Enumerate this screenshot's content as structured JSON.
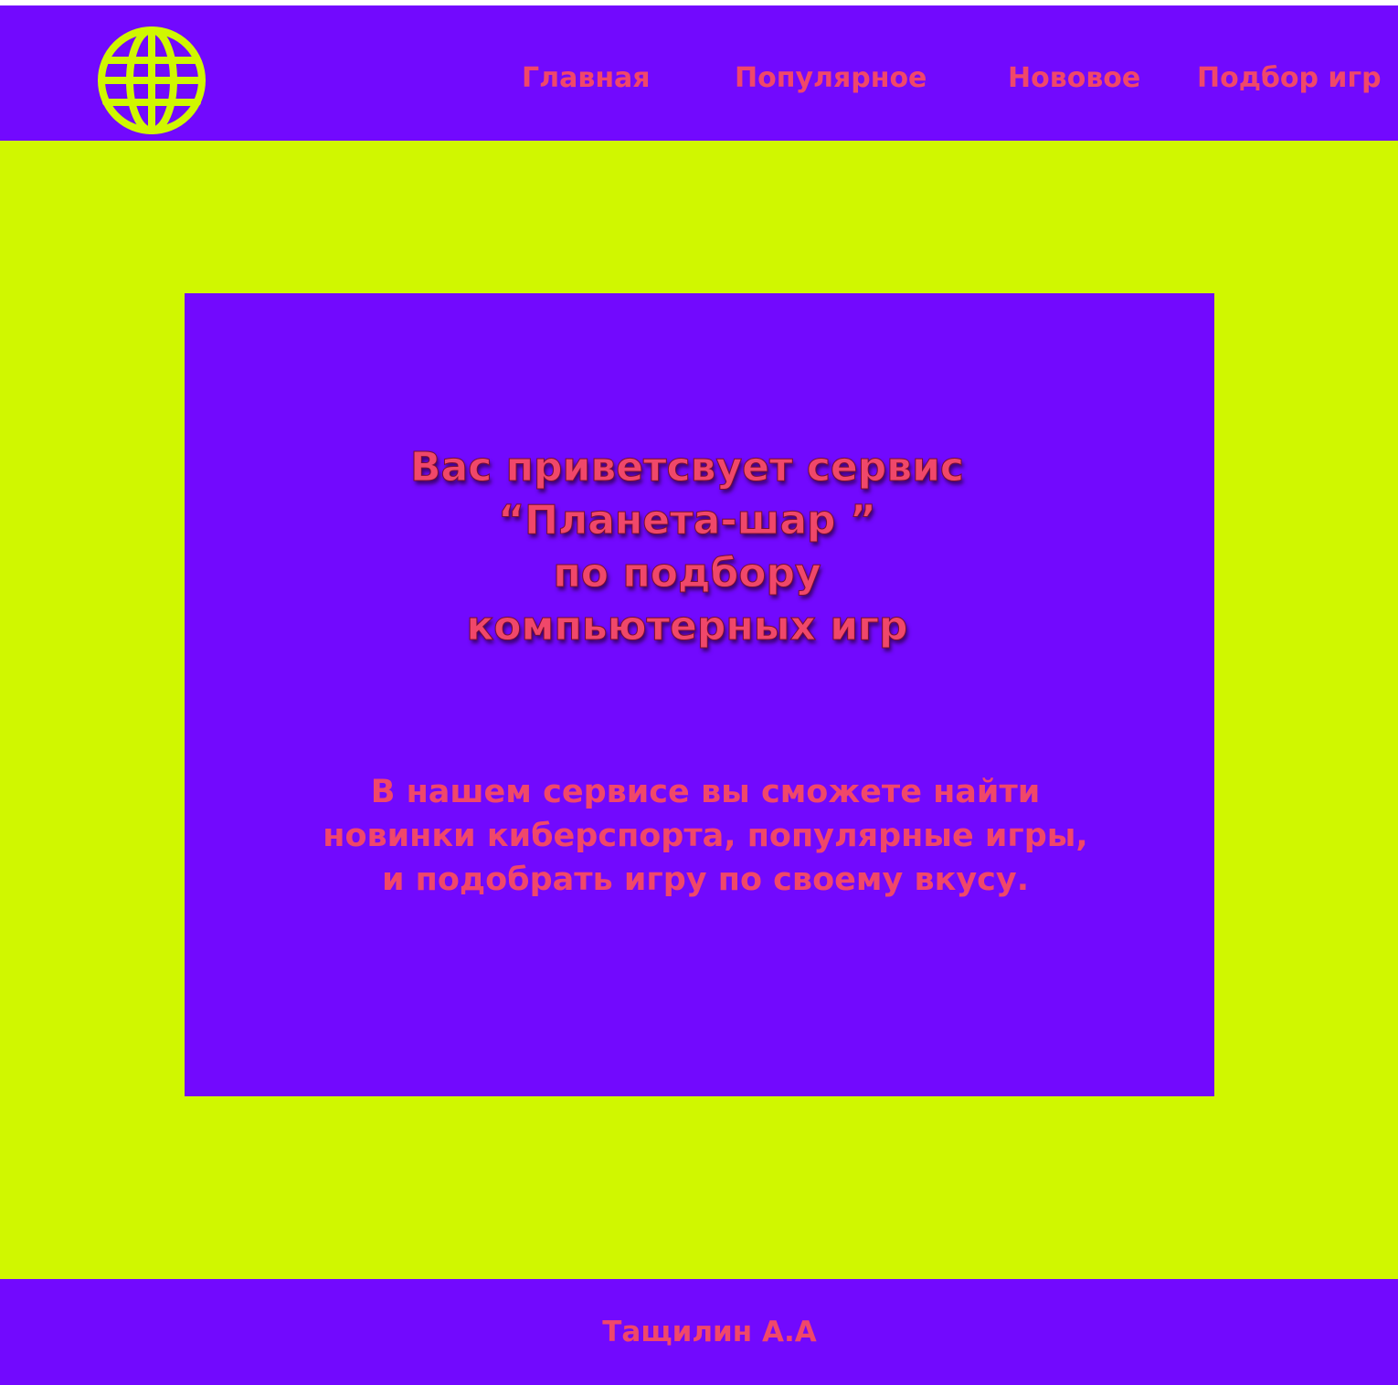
{
  "colors": {
    "purple": "#7209fe",
    "lime": "#d0f700",
    "pink_text": "#f0476a"
  },
  "header": {
    "logo_icon": "globe-icon",
    "nav": [
      {
        "label": "Главная"
      },
      {
        "label": "Популярное"
      },
      {
        "label": "Нововое"
      },
      {
        "label": "Подбор игр"
      }
    ]
  },
  "hero": {
    "title_lines": [
      "Вас приветсвует сервис",
      "“Планета-шар ”",
      "по подбору",
      "компьютерных игр"
    ],
    "text_lines": [
      "В нашем сервисе вы сможете найти",
      "новинки киберспорта, популярные игры,",
      "и подобрать игру по своему вкусу."
    ]
  },
  "footer": {
    "author": "Тащилин А.А"
  }
}
